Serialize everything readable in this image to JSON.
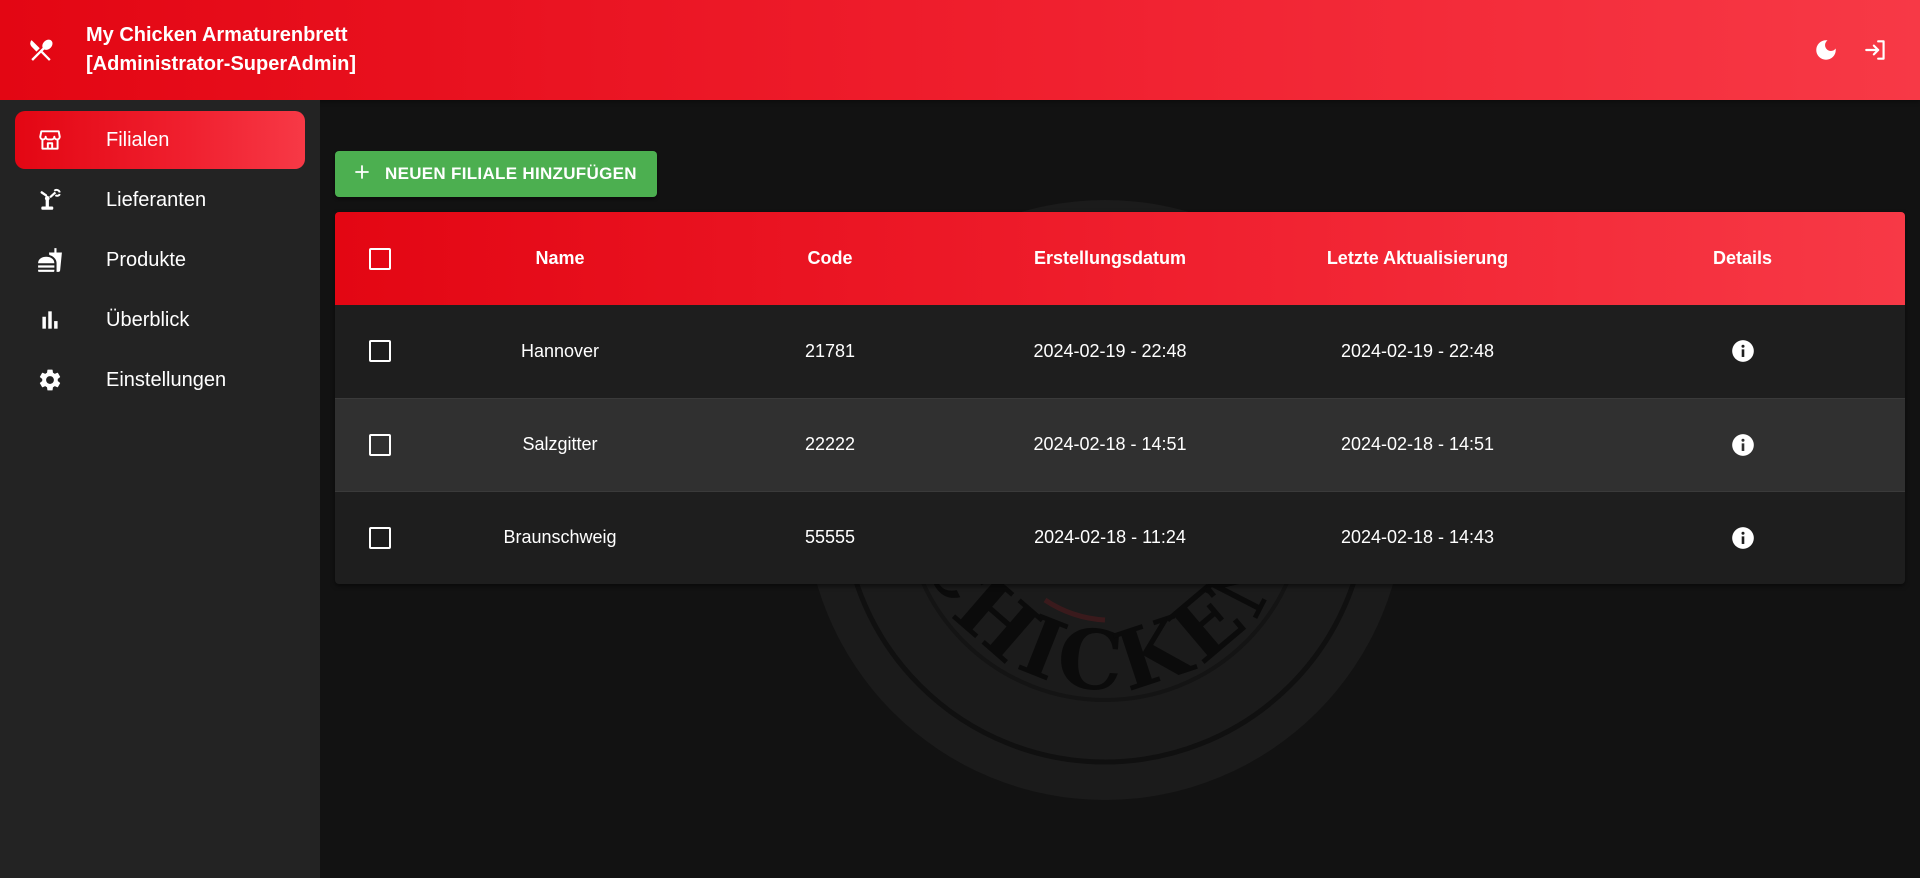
{
  "header": {
    "title": "My Chicken Armaturenbrett",
    "subtitle": "[Administrator-SuperAdmin]",
    "icons": [
      "cutlery-icon",
      "moon-icon",
      "logout-icon"
    ]
  },
  "sidebar": {
    "items": [
      {
        "label": "Filialen",
        "icon": "store-icon",
        "active": true
      },
      {
        "label": "Lieferanten",
        "icon": "supplier-icon",
        "active": false
      },
      {
        "label": "Produkte",
        "icon": "fastfood-icon",
        "active": false
      },
      {
        "label": "Überblick",
        "icon": "bar-chart-icon",
        "active": false
      },
      {
        "label": "Einstellungen",
        "icon": "gear-icon",
        "active": false
      }
    ]
  },
  "main": {
    "add_button_label": "NEUEN FILIALE HINZUFÜGEN",
    "watermark_text": "CHICKEN",
    "table": {
      "columns": [
        "Name",
        "Code",
        "Erstellungsdatum",
        "Letzte Aktualisierung",
        "Details"
      ],
      "rows": [
        {
          "name": "Hannover",
          "code": "21781",
          "created": "2024-02-19 - 22:48",
          "updated": "2024-02-19 - 22:48"
        },
        {
          "name": "Salzgitter",
          "code": "22222",
          "created": "2024-02-18 - 14:51",
          "updated": "2024-02-18 - 14:51"
        },
        {
          "name": "Braunschweig",
          "code": "55555",
          "created": "2024-02-18 - 11:24",
          "updated": "2024-02-18 - 14:43"
        }
      ]
    }
  },
  "colors": {
    "brand_red": "#e30613",
    "brand_red_light": "#f73946",
    "add_green": "#4caf50",
    "sidebar_bg": "#232323",
    "page_bg": "#121212"
  }
}
